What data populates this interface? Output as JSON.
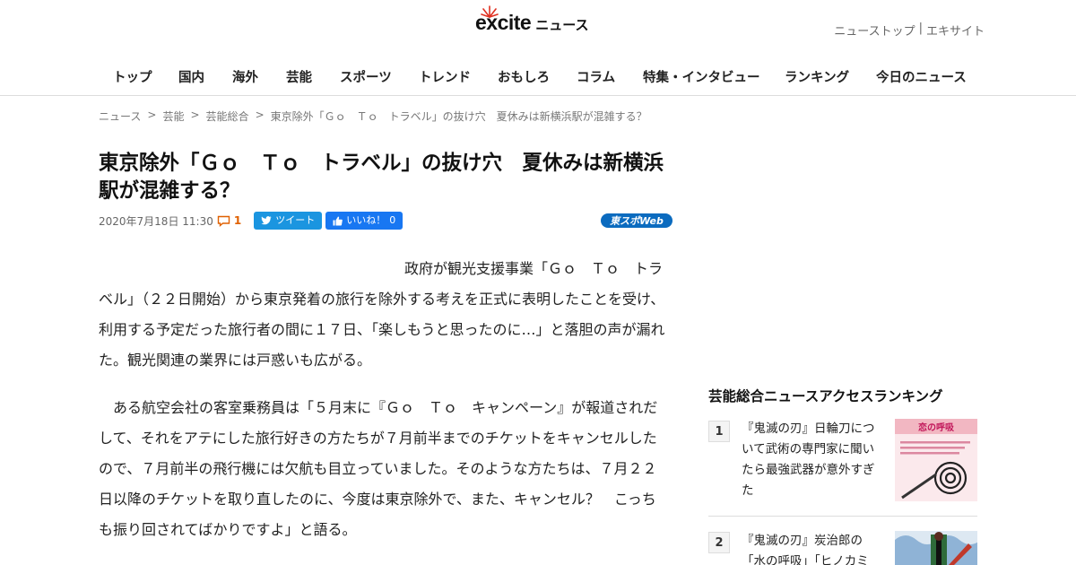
{
  "header": {
    "logo_main": "excite",
    "logo_sub": "ニュース",
    "top_links": [
      "ニューストップ",
      "|",
      "エキサイト"
    ]
  },
  "nav": {
    "items": [
      "トップ",
      "国内",
      "海外",
      "芸能",
      "スポーツ",
      "トレンド",
      "おもしろ",
      "コラム",
      "特集・インタビュー",
      "ランキング",
      "今日のニュース"
    ]
  },
  "breadcrumb": [
    "ニュース",
    ">",
    "芸能",
    ">",
    "芸能総合",
    ">",
    "東京除外「Ｇｏ　Ｔｏ　トラベル」の抜け穴　夏休みは新横浜駅が混雑する？"
  ],
  "article": {
    "title": "東京除外「Ｇｏ　Ｔｏ　トラベル」の抜け穴　夏休みは新横浜駅が混雑する？",
    "date": "2020年7月18日 11:30",
    "comment_count": "1",
    "tweet_label": "ツイート",
    "like_label": "いいね！",
    "like_count": "0",
    "source": "東スポWeb",
    "paragraphs": [
      "政府が観光支援事業「Ｇｏ　Ｔｏ　トラベル」（２２日開始）から東京発着の旅行を除外する考えを正式に表明したことを受け、利用する予定だった旅行者の間に１７日、「楽しもうと思ったのに…」と落胆の声が漏れた。観光関連の業界には戸惑いも広がる。",
      "ある航空会社の客室乗務員は「５月末に『Ｇｏ　Ｔｏ　キャンペーン』が報道されだして、それをアテにした旅行好きの方たちが７月前半までのチケットをキャンセルしたので、７月前半の飛行機には欠航も目立っていました。そのような方たちは、７月２２日以降のチケットを取り直したのに、今度は東京除外で、また、キャンセル？　こっちも振り回されてばかりですよ」と語る。"
    ]
  },
  "ranking": {
    "title": "芸能総合ニュースアクセスランキング",
    "items": [
      {
        "rank": "1",
        "text": "『鬼滅の刃』日輪刀について武術の専門家に聞いたら最強武器が意外すぎた",
        "thumb_caption": "恋の呼吸"
      },
      {
        "rank": "2",
        "text": "『鬼滅の刃』炭治郎の「水の呼吸」「ヒノカミ"
      }
    ]
  },
  "colors": {
    "accent_orange": "#e06000",
    "twitter_blue": "#1b95e0",
    "facebook_blue": "#1877f2",
    "source_blue": "#0b6bbf"
  }
}
